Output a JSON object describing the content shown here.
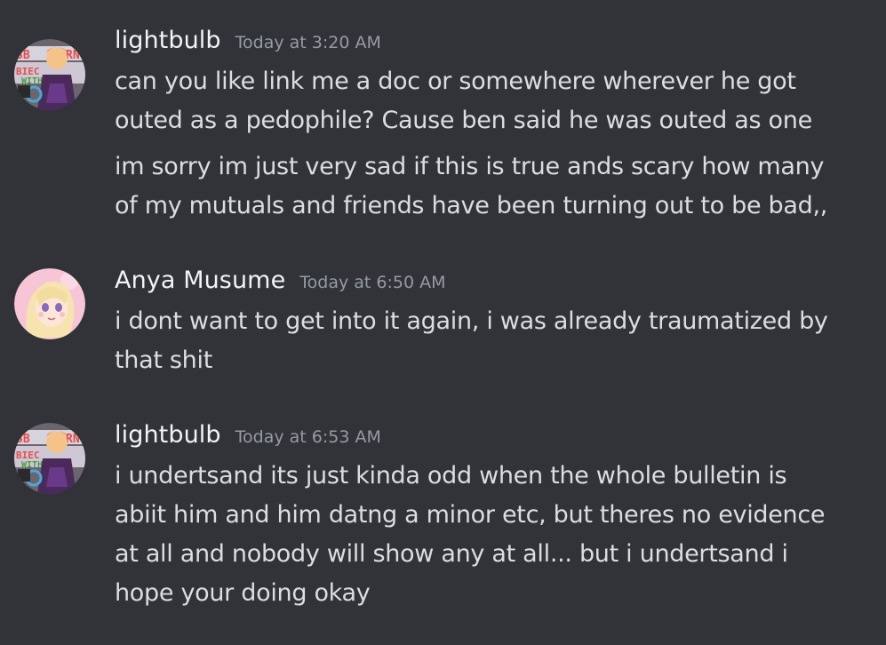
{
  "messages": [
    {
      "username": "lightbulb",
      "timestamp": "Today at 3:20 AM",
      "avatar_icon": "lightbulb-avatar",
      "lines": [
        [
          "can you like link me a doc or somewhere wherever he got",
          "outed as a pedophile? Cause ben said he was outed as one"
        ],
        [
          "im sorry im just very sad if this is true ands scary how many",
          "of my mutuals and friends have been turning out to be bad,,"
        ]
      ]
    },
    {
      "username": "Anya Musume",
      "timestamp": "Today at 6:50 AM",
      "avatar_icon": "anya-musume-avatar",
      "lines": [
        [
          "i dont want to get into it again, i was already traumatized by",
          "that shit"
        ]
      ]
    },
    {
      "username": "lightbulb",
      "timestamp": "Today at 6:53 AM",
      "avatar_icon": "lightbulb-avatar",
      "lines": [
        [
          "i undertsand its just kinda odd when the whole bulletin is",
          "abiit him and him datng a minor etc, but theres no evidence",
          "at all and nobody will show any at all... but i undertsand i",
          "hope your doing okay"
        ]
      ]
    }
  ],
  "colors": {
    "background": "#313338",
    "username": "#f2f3f5",
    "timestamp": "#949ba4",
    "text": "#dbdee1"
  }
}
